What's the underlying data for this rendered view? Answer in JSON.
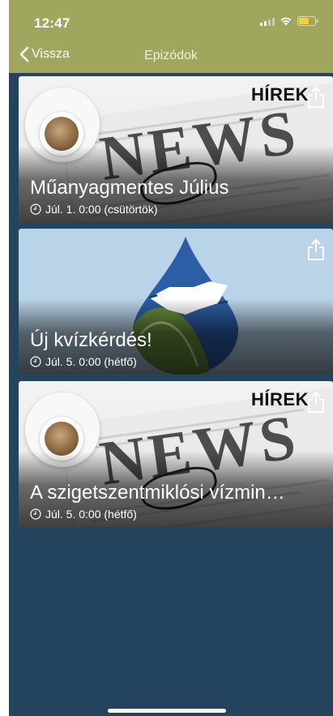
{
  "status_bar": {
    "time": "12:47"
  },
  "nav": {
    "back_label": "Vissza",
    "title": "Epizódok"
  },
  "episodes": [
    {
      "title": "Műanyagmentes Július",
      "date": "Júl. 1. 0:00 (csütörtök)",
      "image": "news-paper-coffee",
      "badge": "HÍREK",
      "overlay_word": "NEWS"
    },
    {
      "title": "Új kvízkérdés!",
      "date": "Júl. 5. 0:00 (hétfő)",
      "image": "water-drop-handshake"
    },
    {
      "title": "A szigetszentmiklósi vízmin…",
      "date": "Júl. 5. 0:00 (hétfő)",
      "image": "news-paper-coffee",
      "badge": "HÍREK",
      "overlay_word": "NEWS"
    }
  ],
  "colors": {
    "header": "#a0a65e",
    "background": "#24445e"
  },
  "icons": {
    "back": "chevron-left-icon",
    "share": "share-icon",
    "clock": "clock-icon"
  }
}
